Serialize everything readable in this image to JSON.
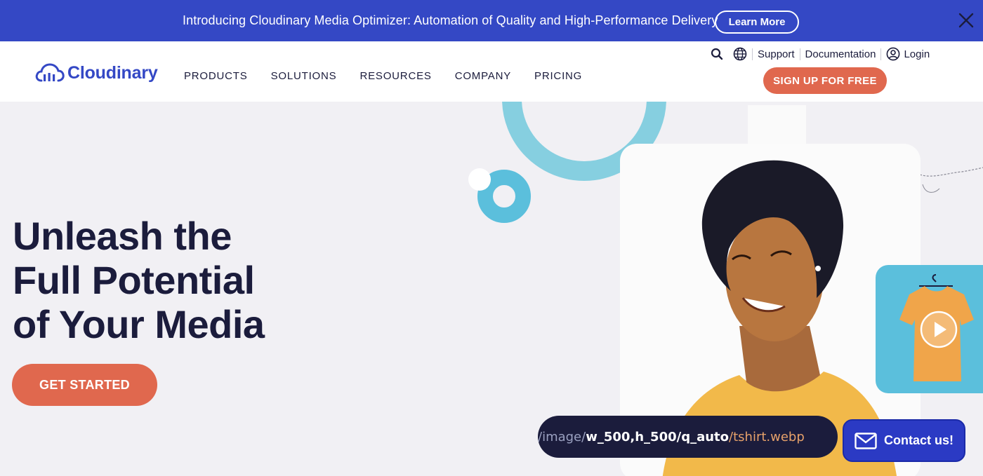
{
  "announcement": {
    "text": "Introducing Cloudinary Media Optimizer: Automation of Quality and High-Performance Delivery",
    "button_label": "Learn More",
    "close_icon": "close-icon"
  },
  "header": {
    "logo_text": "Cloudinary",
    "nav": [
      {
        "label": "PRODUCTS"
      },
      {
        "label": "SOLUTIONS"
      },
      {
        "label": "RESOURCES"
      },
      {
        "label": "COMPANY"
      },
      {
        "label": "PRICING"
      }
    ],
    "utility": {
      "search_icon": "search-icon",
      "language_icon": "globe-icon",
      "support": "Support",
      "documentation": "Documentation",
      "login": "Login",
      "login_icon": "user-icon"
    },
    "signup_label": "SIGN UP FOR FREE"
  },
  "hero": {
    "title_lines": [
      "Unleash the",
      "Full Potential",
      "of Your Media"
    ],
    "cta_label": "GET STARTED",
    "url_example": {
      "path": "/image/",
      "params": "w_500,h_500/q_auto",
      "file": "/tshirt.webp"
    }
  },
  "contact": {
    "label": "Contact us!",
    "icon": "envelope-icon"
  },
  "colors": {
    "brand_blue": "#3448c5",
    "accent_orange": "#e0684e",
    "navy": "#1b1c3c",
    "hero_bg": "#f1f0f4",
    "light_blue": "#5bbfdc"
  }
}
